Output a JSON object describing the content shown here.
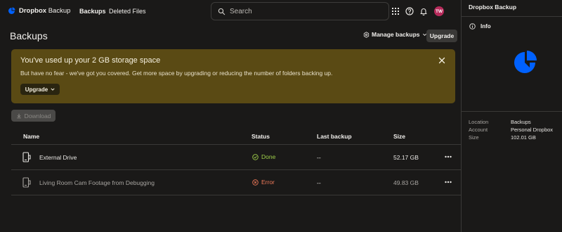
{
  "app": {
    "brand": "Dropbox",
    "product": "Backup"
  },
  "nav": {
    "tabs": [
      {
        "label": "Backups",
        "active": true
      },
      {
        "label": "Deleted Files",
        "active": false
      }
    ]
  },
  "search": {
    "placeholder": "Search"
  },
  "user": {
    "initials": "TW",
    "avatar_color": "#b62a5a"
  },
  "header": {
    "title": "Backups",
    "manage_label": "Manage backups",
    "upgrade_label": "Upgrade"
  },
  "banner": {
    "title": "You've used up your 2 GB storage space",
    "text": "But have no fear - we've got you covered. Get more space by upgrading or reducing the number of folders backing up.",
    "upgrade_label": "Upgrade",
    "background": "#5a4a14"
  },
  "toolbar": {
    "download_label": "Download"
  },
  "table": {
    "columns": {
      "name": "Name",
      "status": "Status",
      "last_backup": "Last backup",
      "size": "Size"
    },
    "rows": [
      {
        "name": "External Drive",
        "status": "Done",
        "last_backup": "--",
        "size": "52.17 GB",
        "status_color": "#9fcf4a"
      },
      {
        "name": "Living Room Cam Footage from Debugging",
        "status": "Error",
        "last_backup": "--",
        "size": "49.83 GB",
        "status_color": "#f07a5a"
      }
    ]
  },
  "sidebar": {
    "title": "Dropbox Backup",
    "info_label": "Info",
    "meta": [
      {
        "key": "Location",
        "value": "Backups"
      },
      {
        "key": "Account",
        "value": "Personal Dropbox"
      },
      {
        "key": "Size",
        "value": "102.01 GB"
      }
    ]
  },
  "colors": {
    "accent": "#0061fe",
    "background": "#1a1918"
  }
}
